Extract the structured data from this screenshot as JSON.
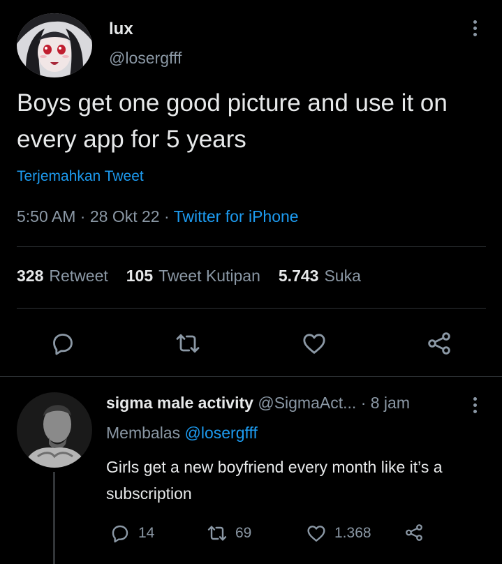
{
  "tweet": {
    "author": {
      "name": "lux",
      "handle": "@losergfff"
    },
    "text": "Boys get one good picture and use it on every app for 5 years",
    "translate_label": "Terjemahkan Tweet",
    "time": "5:50 AM",
    "date": "28 Okt 22",
    "source": "Twitter for iPhone",
    "stats": {
      "retweets": "328",
      "retweets_label": "Retweet",
      "quotes": "105",
      "quotes_label": "Tweet Kutipan",
      "likes": "5.743",
      "likes_label": "Suka"
    },
    "actions": [
      "reply-icon",
      "retweet-icon",
      "like-icon",
      "share-icon"
    ]
  },
  "reply": {
    "author": {
      "name": "sigma male activity",
      "handle": "@SigmaAct...",
      "time": "8 jam"
    },
    "replying_label": "Membalas",
    "replying_to": "@losergfff",
    "text": "Girls get a new boyfriend every month like it’s a subscription",
    "counts": {
      "replies": "14",
      "retweets": "69",
      "likes": "1.368"
    }
  },
  "colors": {
    "background": "#000000",
    "text": "#e7e9ea",
    "secondary": "#8b98a5",
    "accent": "#1d9bf0",
    "divider": "#2f3336"
  }
}
